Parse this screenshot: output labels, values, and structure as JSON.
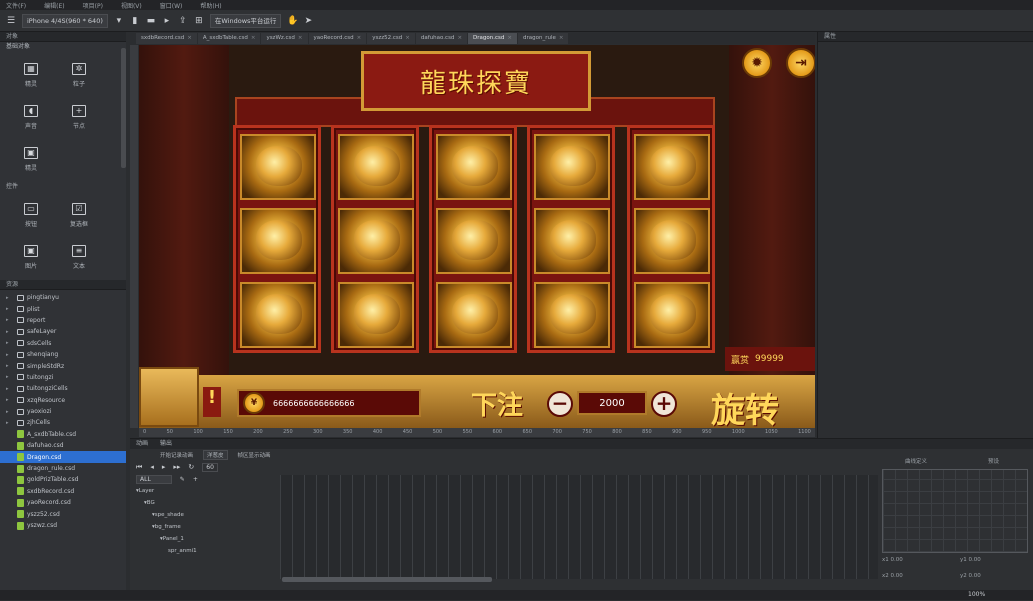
{
  "menubar": {
    "items": [
      "文件(F)",
      "编辑(E)",
      "项目(P)",
      "视图(V)",
      "窗口(W)",
      "帮助(H)"
    ]
  },
  "toolbar": {
    "device": "iPhone 4/4S(960 * 640)",
    "run_target": "在Windows平台运行"
  },
  "left_panel": {
    "objects_title": "对象",
    "basic_objects_title": "基础对象",
    "basic_objects": [
      {
        "label": "精灵",
        "icon": "sprite-icon"
      },
      {
        "label": "粒子",
        "icon": "particle-icon"
      },
      {
        "label": "声音",
        "icon": "audio-icon"
      },
      {
        "label": "节点",
        "icon": "node-icon"
      },
      {
        "label": "精灵",
        "icon": "image-icon"
      }
    ],
    "controls_title": "控件",
    "controls": [
      {
        "label": "按钮",
        "icon": "button-icon"
      },
      {
        "label": "复选框",
        "icon": "checkbox-icon"
      },
      {
        "label": "图片",
        "icon": "image-icon"
      },
      {
        "label": "文本",
        "icon": "text-icon"
      }
    ],
    "resources_title": "资源",
    "files": [
      {
        "name": "pingtianyu",
        "type": "folder"
      },
      {
        "name": "plist",
        "type": "folder"
      },
      {
        "name": "report",
        "type": "folder"
      },
      {
        "name": "safeLayer",
        "type": "folder"
      },
      {
        "name": "sdsCells",
        "type": "folder"
      },
      {
        "name": "shenqiang",
        "type": "folder"
      },
      {
        "name": "simpleStdRz",
        "type": "folder"
      },
      {
        "name": "tuitongzi",
        "type": "folder"
      },
      {
        "name": "tuitongziCells",
        "type": "folder"
      },
      {
        "name": "xzqResource",
        "type": "folder"
      },
      {
        "name": "yaoxiozi",
        "type": "folder"
      },
      {
        "name": "zjhCells",
        "type": "folder"
      },
      {
        "name": "A_sxdbTable.csd",
        "type": "csd"
      },
      {
        "name": "dafuhao.csd",
        "type": "csd"
      },
      {
        "name": "Dragon.csd",
        "type": "csd",
        "selected": true
      },
      {
        "name": "dragon_rule.csd",
        "type": "csd"
      },
      {
        "name": "goldPrizTable.csd",
        "type": "csd"
      },
      {
        "name": "sxdbRecord.csd",
        "type": "csd"
      },
      {
        "name": "yaoRecord.csd",
        "type": "csd"
      },
      {
        "name": "yszz52.csd",
        "type": "csd"
      },
      {
        "name": "yszwz.csd",
        "type": "csd"
      }
    ]
  },
  "tabs": [
    {
      "label": "sxdbRecord.csd",
      "active": false
    },
    {
      "label": "A_sxdbTable.csd",
      "active": false
    },
    {
      "label": "yszWz.csd",
      "active": false
    },
    {
      "label": "yaoRecord.csd",
      "active": false
    },
    {
      "label": "yszz52.csd",
      "active": false
    },
    {
      "label": "dafuhao.csd",
      "active": false
    },
    {
      "label": "Dragon.csd",
      "active": true
    },
    {
      "label": "dragon_rule",
      "active": false
    }
  ],
  "scene": {
    "title": "龍珠探寶",
    "bonus_label": "赢赏",
    "bonus_value": "99999",
    "coins_value": "6666666666666666",
    "bet_label": "下注",
    "bet_value": "2000",
    "minus_label": "−",
    "plus_label": "+",
    "spin_label": "旋转",
    "settings_icon": "gear-icon",
    "exit_icon": "exit-icon"
  },
  "ruler_ticks": [
    "0",
    "50",
    "100",
    "150",
    "200",
    "250",
    "300",
    "350",
    "400",
    "450",
    "500",
    "550",
    "600",
    "650",
    "700",
    "750",
    "800",
    "850",
    "900",
    "950",
    "1000",
    "1050",
    "1100"
  ],
  "right_panel": {
    "title": "属性"
  },
  "timeline": {
    "tabs": [
      "动画",
      "输出"
    ],
    "record_label": "开始记录动画",
    "onion_label": "洋葱皮",
    "show_label": "帧区显示动画",
    "fps": "60",
    "filter": "ALL",
    "layers": [
      {
        "name": "Layer",
        "indent": 0
      },
      {
        "name": "BG",
        "indent": 1
      },
      {
        "name": "spe_shade",
        "indent": 2
      },
      {
        "name": "bg_frame",
        "indent": 2
      },
      {
        "name": "Panel_1",
        "indent": 3
      },
      {
        "name": "spr_anmi1",
        "indent": 4
      }
    ],
    "curve_header_left": "曲线定义",
    "curve_header_right": "预设",
    "x1": "0.00",
    "y1": "0.00",
    "x2": "0.00",
    "y2": "0.00"
  },
  "statusbar": {
    "zoom": "100%"
  }
}
